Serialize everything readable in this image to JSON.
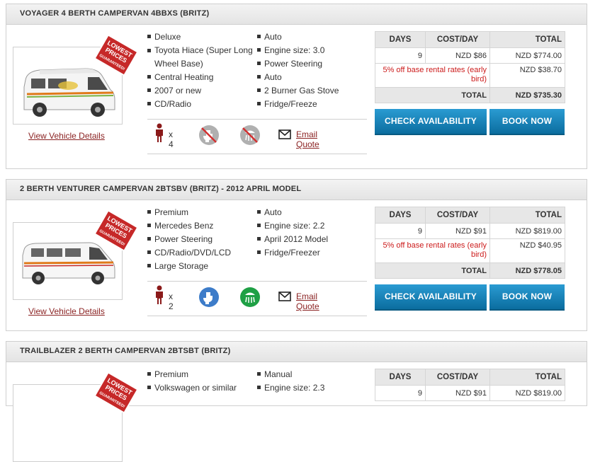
{
  "vehicles": [
    {
      "title": "VOYAGER 4 BERTH CAMPERVAN 4BBXS (BRITZ)",
      "stamp": "LOWEST PRICES GUARANTEED!",
      "view_link": "View Vehicle Details",
      "features_left": [
        "Deluxe",
        "Toyota Hiace (Super Long Wheel Base)",
        "Central Heating",
        "2007 or new",
        "CD/Radio"
      ],
      "features_right": [
        "Auto",
        "Engine size: 3.0",
        "Power Steering",
        "Auto",
        "2 Burner Gas Stove",
        "Fridge/Freeze"
      ],
      "person_count": "x 4",
      "toilet": "toilet-unavailable-icon",
      "shower": "shower-unavailable-icon",
      "email_link": "Email Quote",
      "price": {
        "headers": [
          "DAYS",
          "COST/DAY",
          "TOTAL"
        ],
        "days": "9",
        "cost_per_day": "NZD $86",
        "total": "NZD $774.00",
        "discount_label": "5% off base rental rates (early bird)",
        "discount_amount": "NZD $38.70",
        "final_label": "TOTAL",
        "final_total": "NZD $735.30"
      },
      "check_button": "CHECK AVAILABILITY",
      "book_button": "BOOK NOW"
    },
    {
      "title": "2 BERTH VENTURER CAMPERVAN 2BTSBV (BRITZ) - 2012 APRIL MODEL",
      "stamp": "LOWEST PRICES GUARANTEED!",
      "view_link": "View Vehicle Details",
      "features_left": [
        "Premium",
        "Mercedes Benz",
        "Power Steering",
        "CD/Radio/DVD/LCD",
        "Large Storage"
      ],
      "features_right": [
        "Auto",
        "Engine size: 2.2",
        "April 2012 Model",
        "Fridge/Freezer"
      ],
      "person_count": "x 2",
      "toilet": "toilet-available-icon",
      "shower": "shower-available-icon",
      "email_link": "Email Quote",
      "price": {
        "headers": [
          "DAYS",
          "COST/DAY",
          "TOTAL"
        ],
        "days": "9",
        "cost_per_day": "NZD $91",
        "total": "NZD $819.00",
        "discount_label": "5% off base rental rates (early bird)",
        "discount_amount": "NZD $40.95",
        "final_label": "TOTAL",
        "final_total": "NZD $778.05"
      },
      "check_button": "CHECK AVAILABILITY",
      "book_button": "BOOK NOW"
    },
    {
      "title": "TRAILBLAZER 2 BERTH CAMPERVAN 2BTSBT (BRITZ)",
      "stamp": "LOWEST PRICES GUARANTEED!",
      "features_left": [
        "Premium",
        "Volkswagen or similar"
      ],
      "features_right": [
        "Manual",
        "Engine size: 2.3"
      ],
      "price": {
        "headers": [
          "DAYS",
          "COST/DAY",
          "TOTAL"
        ],
        "days": "9",
        "cost_per_day": "NZD $91",
        "total": "NZD $819.00"
      }
    }
  ],
  "colors": {
    "link": "#8b2323",
    "discount_text": "#cc1b1b",
    "button_top": "#2a9bd2",
    "button_bottom": "#0b6d9f",
    "stamp": "#c62828",
    "available_blue": "#3d7cc9",
    "available_green": "#1fa045",
    "unavailable_gray": "#b0b0b0"
  }
}
